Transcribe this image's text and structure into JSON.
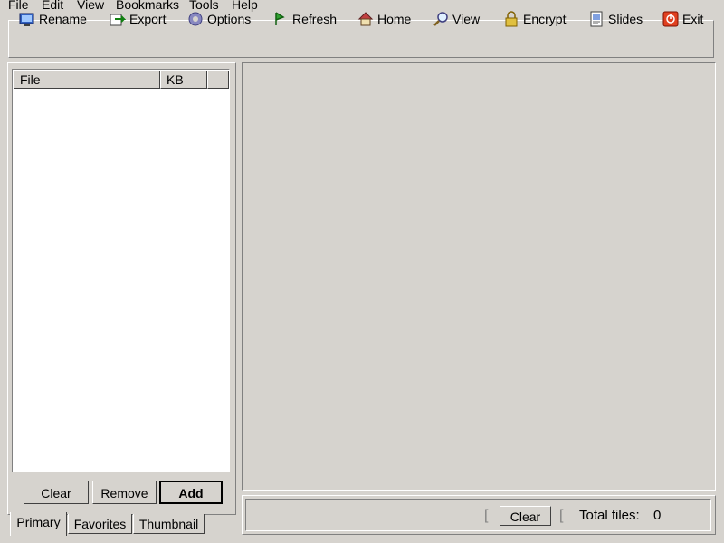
{
  "menu": {
    "file": "File",
    "edit": "Edit",
    "view": "View",
    "bookmarks": "Bookmarks",
    "tools": "Tools",
    "help": "Help"
  },
  "toolbar": {
    "rename": "Rename",
    "export": "Export",
    "options": "Options",
    "refresh": "Refresh",
    "home": "Home",
    "view": "View",
    "encrypt": "Encrypt",
    "slides": "Slides",
    "exit": "Exit"
  },
  "filelist": {
    "columns": [
      "File",
      "KB"
    ]
  },
  "buttons": {
    "clear": "Clear",
    "remove": "Remove",
    "add": "Add"
  },
  "tabs": [
    "Primary",
    "Favorites",
    "Thumbnail"
  ],
  "status": {
    "clear": "Clear",
    "total_label": "Total files:",
    "total_value": "0"
  },
  "colors": {
    "window_bg": "#d6d3ce",
    "list_bg": "#ffffff"
  }
}
